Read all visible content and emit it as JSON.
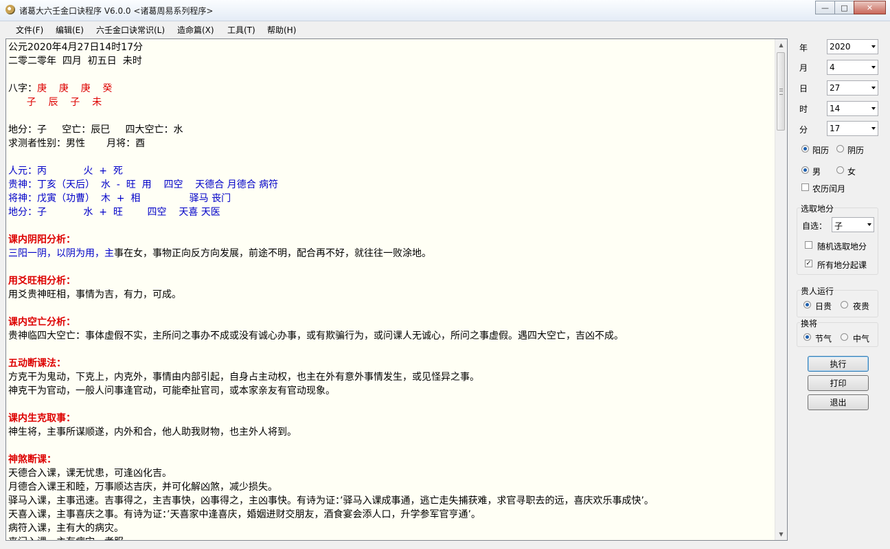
{
  "window": {
    "title": "诸葛大六壬金口诀程序 V6.0.0   <诸葛周易系列程序>",
    "minimize": "—",
    "maximize": "□",
    "close": "✕"
  },
  "menu": [
    "文件(F)",
    "编辑(E)",
    "六壬金口诀常识(L)",
    "造命篇(X)",
    "工具(T)",
    "帮助(H)"
  ],
  "content": {
    "lines": [
      [
        {
          "t": "公元2020年4月27日14时17分"
        }
      ],
      [
        {
          "t": "二零二零年  四月  初五日  未时"
        }
      ],
      [
        {
          "t": ""
        }
      ],
      [
        {
          "t": "八字："
        },
        {
          "t": "庚    庚    庚    癸",
          "c": "red"
        }
      ],
      [
        {
          "t": "      "
        },
        {
          "t": "子    辰    子    未",
          "c": "red"
        }
      ],
      [
        {
          "t": ""
        }
      ],
      [
        {
          "t": "地分：子     空亡：辰巳     四大空亡：水"
        }
      ],
      [
        {
          "t": "求测者性别：男性       月将：酉"
        }
      ],
      [
        {
          "t": ""
        }
      ],
      [
        {
          "t": "人元：丙            火  +  死",
          "c": "blue"
        }
      ],
      [
        {
          "t": "贵神：丁亥（天后）  水  -  旺  用    四空    天德合 月德合 病符",
          "c": "blue"
        }
      ],
      [
        {
          "t": "将神：戊寅（功曹）  木  +  相                驿马 丧门",
          "c": "blue"
        }
      ],
      [
        {
          "t": "地分：子            水  +  旺        四空    天喜 天医",
          "c": "blue"
        }
      ],
      [
        {
          "t": ""
        }
      ],
      [
        {
          "t": "课内阴阳分析：",
          "c": "hdr"
        }
      ],
      [
        {
          "t": "三阳一阴，以阴为用，主",
          "c": "blue"
        },
        {
          "t": "事在女，事物正向反方向发展，前途不明，配合再不好，就往往一败涂地。"
        }
      ],
      [
        {
          "t": ""
        }
      ],
      [
        {
          "t": "用爻旺相分析：",
          "c": "hdr"
        }
      ],
      [
        {
          "t": "用爻贵神旺相，事情为吉，有力，可成。"
        }
      ],
      [
        {
          "t": ""
        }
      ],
      [
        {
          "t": "课内空亡分析：",
          "c": "hdr"
        }
      ],
      [
        {
          "t": "贵神临四大空亡：事体虚假不实，主所问之事办不成或没有诚心办事，或有欺骗行为，或问课人无诚心，所问之事虚假。遇四大空亡，吉凶不成。"
        }
      ],
      [
        {
          "t": ""
        }
      ],
      [
        {
          "t": "五动断课法：",
          "c": "hdr"
        }
      ],
      [
        {
          "t": "方克干为鬼动，下克上，内克外，事情由内部引起，自身占主动权，也主在外有意外事情发生，或见怪异之事。"
        }
      ],
      [
        {
          "t": "神克干为官动，一般人问事逢官动，可能牵扯官司，或本家亲友有官动现象。"
        }
      ],
      [
        {
          "t": ""
        }
      ],
      [
        {
          "t": "课内生克取事：",
          "c": "hdr"
        }
      ],
      [
        {
          "t": "神生将，主事所谋顺遂，内外和合，他人助我财物，也主外人将到。"
        }
      ],
      [
        {
          "t": ""
        }
      ],
      [
        {
          "t": "神煞断课：",
          "c": "hdr"
        }
      ],
      [
        {
          "t": "天德合入课，课无忧患，可逢凶化吉。"
        }
      ],
      [
        {
          "t": "月德合入课王和睦，万事顺达吉庆，并可化解凶煞，减少损失。"
        }
      ],
      [
        {
          "t": "驿马入课，主事迅速。吉事得之，主吉事快，凶事得之，主凶事快。有诗为证：’驿马入课成事通，逃亡走失捕获难，求官寻职去的远，喜庆欢乐事成快’。"
        }
      ],
      [
        {
          "t": "天喜入课，主事喜庆之事。有诗为证：’天喜家中逢喜庆，婚姻进财交朋友，酒食宴会添人口，升学参军官亨通’。"
        }
      ],
      [
        {
          "t": "病符入课，主有大的病灾。"
        }
      ],
      [
        {
          "t": "丧门入课，主有病灾，孝服。"
        }
      ]
    ]
  },
  "scrollbar": {
    "up": "▲",
    "down": "▼"
  },
  "side": {
    "year_label": "年",
    "year_value": "2020",
    "month_label": "月",
    "month_value": "4",
    "day_label": "日",
    "day_value": "27",
    "hour_label": "时",
    "hour_value": "14",
    "minute_label": "分",
    "minute_value": "17",
    "solar": "阳历",
    "lunar": "阴历",
    "male": "男",
    "female": "女",
    "leap": "农历闰月",
    "dizhi_group": "选取地分",
    "self_select": "自选：",
    "self_value": "子",
    "random": "随机选取地分",
    "all": "所有地分起课",
    "noble_group": "贵人运行",
    "day_noble": "日贵",
    "night_noble": "夜贵",
    "swap_group": "换将",
    "jieqi": "节气",
    "zhongqi": "中气",
    "execute": "执行",
    "print": "打印",
    "exit": "退出",
    "checked": "✓"
  },
  "colors": {
    "text_red": "#dd0000",
    "text_blue": "#0000c8",
    "content_bg": "#fffff5"
  }
}
